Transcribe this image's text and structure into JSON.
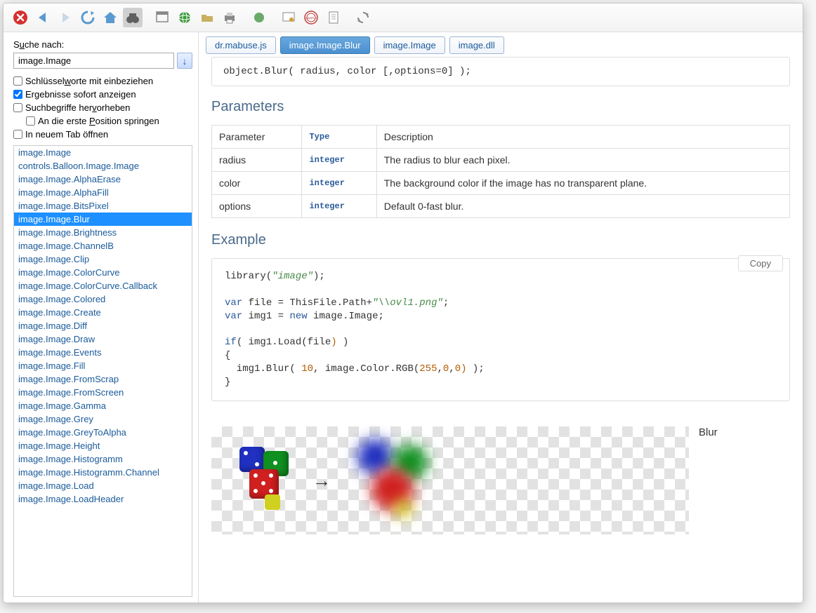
{
  "toolbar_icons": [
    "close",
    "back",
    "forward",
    "refresh",
    "home",
    "search-binoculars",
    "new-window",
    "globe",
    "open-folder",
    "print",
    "page",
    "certificate",
    "sample-stamp",
    "document",
    "sync"
  ],
  "sidebar": {
    "search_label_pre": "S",
    "search_label_u": "u",
    "search_label_post": "che nach:",
    "search_value": "image.Image",
    "chk_keywords_pre": "Schlüssel",
    "chk_keywords_u": "w",
    "chk_keywords_post": "orte mit einbeziehen",
    "chk_keywords_checked": false,
    "chk_instant": "Ergebnisse sofort anzeigen",
    "chk_instant_checked": true,
    "chk_highlight_pre": "Suchbegriffe her",
    "chk_highlight_u": "v",
    "chk_highlight_post": "orheben",
    "chk_highlight_checked": false,
    "chk_firstpos_pre": "An die erste ",
    "chk_firstpos_u": "P",
    "chk_firstpos_post": "osition springen",
    "chk_firstpos_checked": false,
    "chk_newtab": "In neuem Tab öffnen",
    "chk_newtab_checked": false
  },
  "results": [
    "image.Image",
    "controls.Balloon.Image.Image",
    "image.Image.AlphaErase",
    "image.Image.AlphaFill",
    "image.Image.BitsPixel",
    "image.Image.Blur",
    "image.Image.Brightness",
    "image.Image.ChannelB",
    "image.Image.Clip",
    "image.Image.ColorCurve",
    "image.Image.ColorCurve.Callback",
    "image.Image.Colored",
    "image.Image.Create",
    "image.Image.Diff",
    "image.Image.Draw",
    "image.Image.Events",
    "image.Image.Fill",
    "image.Image.FromScrap",
    "image.Image.FromScreen",
    "image.Image.Gamma",
    "image.Image.Grey",
    "image.Image.GreyToAlpha",
    "image.Image.Height",
    "image.Image.Histogramm",
    "image.Image.Histogramm.Channel",
    "image.Image.Load",
    "image.Image.LoadHeader"
  ],
  "selected_index": 5,
  "tabs": [
    "dr.mabuse.js",
    "image.Image.Blur",
    "image.Image",
    "image.dll"
  ],
  "active_tab": 1,
  "doc": {
    "syntax": "object.Blur( radius, color [,options=0] );",
    "h_params": "Parameters",
    "th_param": "Parameter",
    "th_type": "Type",
    "th_desc": "Description",
    "rows": [
      {
        "name": "radius",
        "type": "integer",
        "desc": "The radius to blur each pixel."
      },
      {
        "name": "color",
        "type": "integer",
        "desc": "The background color if the image has no transparent plane."
      },
      {
        "name": "options",
        "type": "integer",
        "desc": "Default 0-fast blur."
      }
    ],
    "h_example": "Example",
    "copy_label": "Copy",
    "caption": "Blur"
  }
}
